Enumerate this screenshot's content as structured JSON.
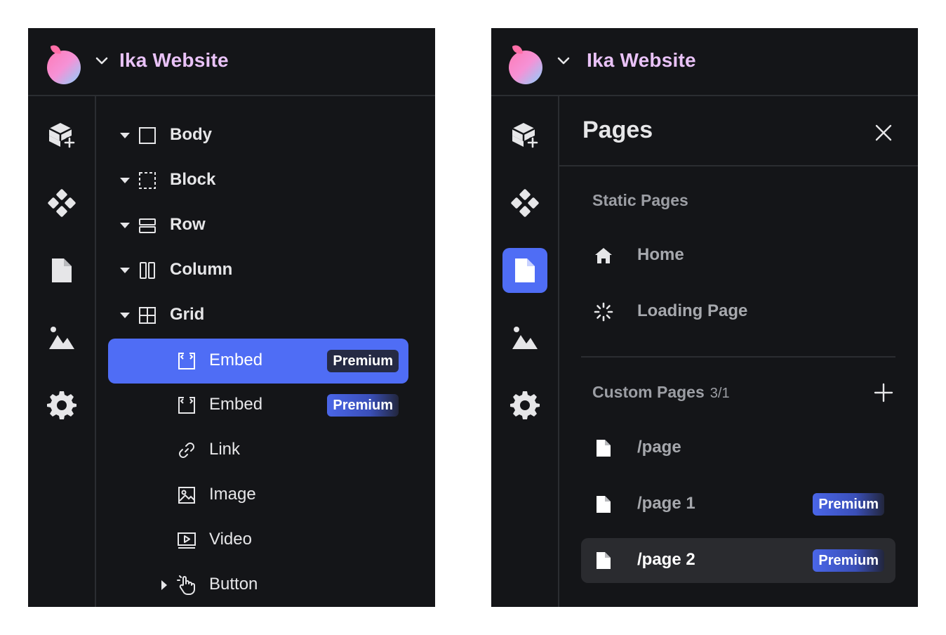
{
  "colors": {
    "panel_bg": "#141518",
    "accent": "#4f6df5",
    "title_pink": "#e9c2f7",
    "divider": "#2b2d31",
    "muted_text": "#9c9ea4"
  },
  "left_panel": {
    "app_title": "Ika Website",
    "rail": [
      {
        "icon": "add-component-cube-icon"
      },
      {
        "icon": "components-diamond-icon"
      },
      {
        "icon": "page-document-icon"
      },
      {
        "icon": "assets-image-icon"
      },
      {
        "icon": "settings-gear-icon"
      }
    ],
    "tree": [
      {
        "label": "Body",
        "icon": "square-icon"
      },
      {
        "label": "Block",
        "icon": "dashed-square-icon"
      },
      {
        "label": "Row",
        "icon": "rows-icon"
      },
      {
        "label": "Column",
        "icon": "columns-icon"
      },
      {
        "label": "Grid",
        "icon": "grid-icon"
      },
      {
        "label": "Embed",
        "icon": "embed-icon",
        "badge": "Premium",
        "selected": true
      },
      {
        "label": "Embed",
        "icon": "embed-icon",
        "badge": "Premium"
      },
      {
        "label": "Link",
        "icon": "link-icon"
      },
      {
        "label": "Image",
        "icon": "image-icon"
      },
      {
        "label": "Video",
        "icon": "video-icon"
      },
      {
        "label": "Button",
        "icon": "pointer-hand-icon"
      }
    ]
  },
  "right_panel": {
    "app_title": "Ika Website",
    "pages_title": "Pages",
    "static_section": {
      "label": "Static Pages",
      "items": [
        {
          "label": "Home",
          "icon": "home-icon"
        },
        {
          "label": "Loading Page",
          "icon": "loading-spinner-icon"
        }
      ]
    },
    "custom_section": {
      "label": "Custom Pages",
      "count": "3/1",
      "items": [
        {
          "label": "/page",
          "icon": "page-document-icon"
        },
        {
          "label": "/page 1",
          "icon": "page-document-icon",
          "badge": "Premium"
        },
        {
          "label": "/page 2",
          "icon": "page-document-icon",
          "badge": "Premium",
          "selected": true
        }
      ]
    }
  }
}
